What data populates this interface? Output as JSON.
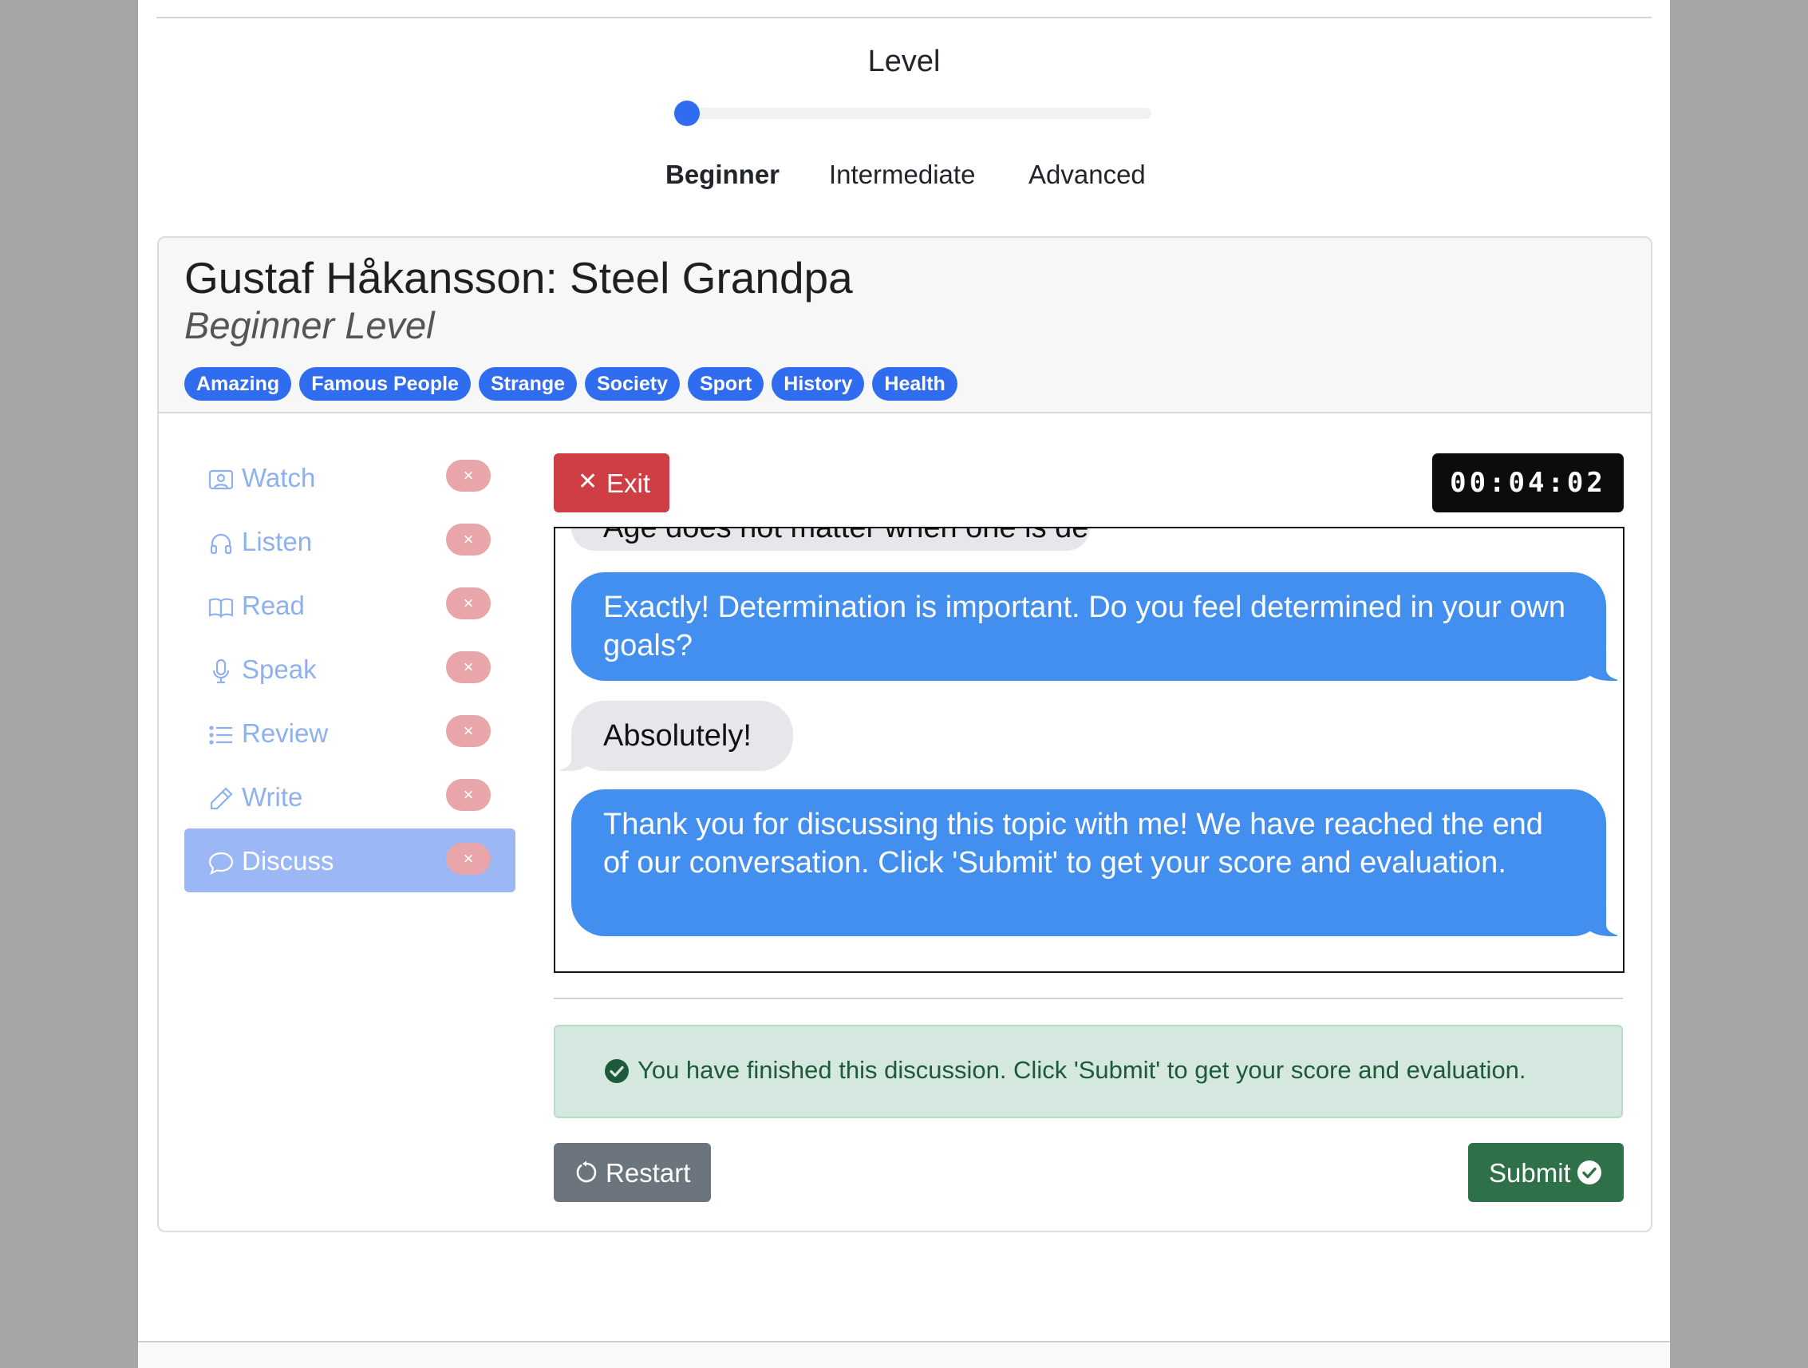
{
  "level": {
    "title": "Level",
    "options": [
      "Beginner",
      "Intermediate",
      "Advanced"
    ],
    "selected": "Beginner",
    "slider_value": 0
  },
  "lesson": {
    "title": "Gustaf Håkansson: Steel Grandpa",
    "subtitle": "Beginner Level",
    "tags": [
      "Amazing",
      "Famous People",
      "Strange",
      "Society",
      "Sport",
      "History",
      "Health"
    ]
  },
  "nav": {
    "items": [
      {
        "label": "Watch",
        "icon": "video-icon",
        "status": "×"
      },
      {
        "label": "Listen",
        "icon": "headphones-icon",
        "status": "×"
      },
      {
        "label": "Read",
        "icon": "book-icon",
        "status": "×"
      },
      {
        "label": "Speak",
        "icon": "microphone-icon",
        "status": "×"
      },
      {
        "label": "Review",
        "icon": "list-icon",
        "status": "×"
      },
      {
        "label": "Write",
        "icon": "pencil-icon",
        "status": "×"
      },
      {
        "label": "Discuss",
        "icon": "chat-icon",
        "status": "×",
        "active": true
      }
    ]
  },
  "discussion": {
    "exit_label": "Exit",
    "timer": "00:04:02",
    "messages": [
      {
        "role": "user",
        "text": "Age does not matter when one is determined."
      },
      {
        "role": "bot",
        "text": "Exactly! Determination is important. Do you feel determined in your own goals?"
      },
      {
        "role": "user",
        "text": "Absolutely!"
      },
      {
        "role": "bot",
        "text": "Thank you for discussing this topic with me! We have reached the end of our conversation. Click 'Submit' to get your score and evaluation."
      }
    ],
    "alert": "You have finished this discussion. Click 'Submit' to get your score and evaluation.",
    "restart_label": "Restart",
    "submit_label": "Submit"
  },
  "colors": {
    "primary": "#2f6cf0",
    "danger": "#d03e45",
    "success": "#2e7048",
    "secondary": "#6c757d",
    "bot_bubble": "#428ff0",
    "user_bubble": "#e6e6eb"
  }
}
